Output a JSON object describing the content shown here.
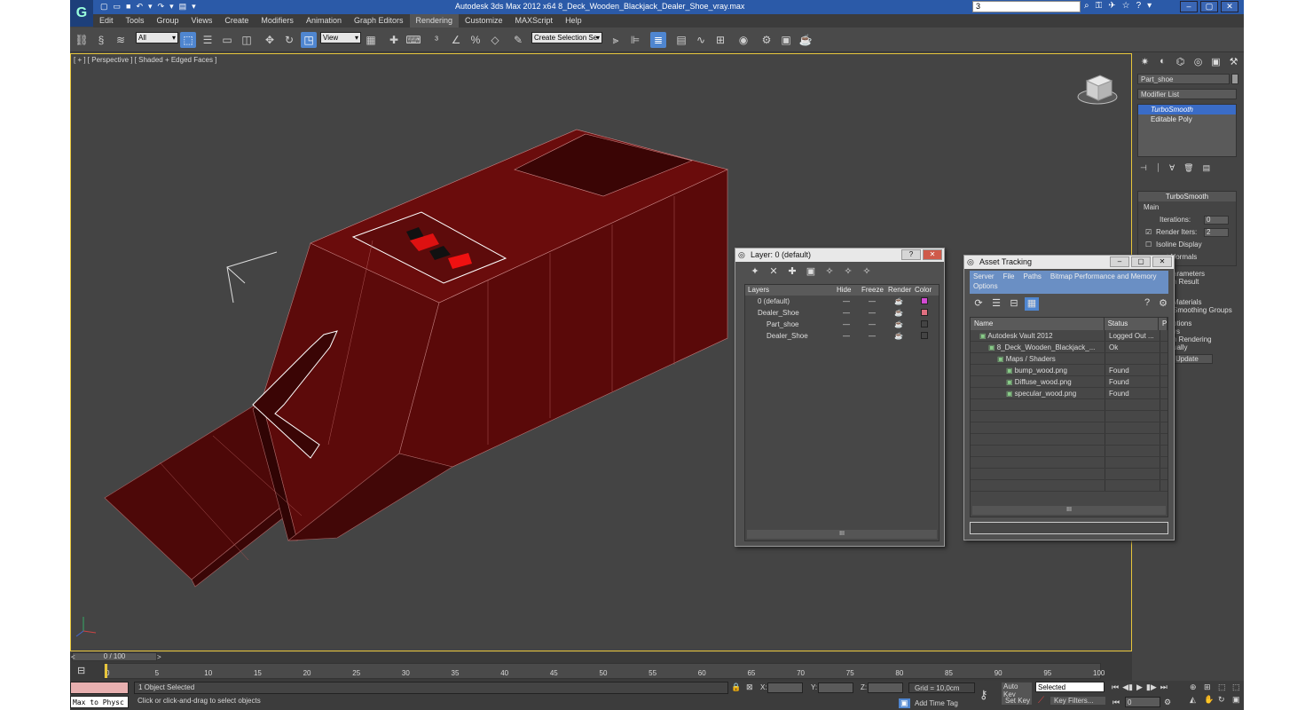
{
  "app": {
    "logo": "G",
    "title": "Autodesk 3ds Max  2012 x64     8_Deck_Wooden_Blackjack_Dealer_Shoe_vray.max",
    "search_value": "3"
  },
  "menu": [
    "Edit",
    "Tools",
    "Group",
    "Views",
    "Create",
    "Modifiers",
    "Animation",
    "Graph Editors",
    "Rendering",
    "Customize",
    "MAXScript",
    "Help"
  ],
  "toolbar": {
    "selection_filter": "All",
    "reference_coord": "View",
    "named_selection_placeholder": "Create Selection Se"
  },
  "viewport": {
    "label": "[ + ] [ Perspective ] [ Shaded + Edged Faces ]",
    "accent_color": "#e7c53b",
    "model_color": "#5a0a0a"
  },
  "command_panel": {
    "object_name": "Part_shoe",
    "modifier_list": "Modifier List",
    "stack": [
      "TurboSmooth",
      "Editable Poly"
    ],
    "rollout_title": "TurboSmooth",
    "main_label": "Main",
    "iterations_label": "Iterations:",
    "iterations_value": "0",
    "render_iters_label": "Render Iters:",
    "render_iters_value": "2",
    "isoline_label": "Isoline Display",
    "explicit_normals_label": "t Normals",
    "params_label": "arameters",
    "smooth_result_label": "h Result",
    "materials_label": "Materials",
    "smoothing_groups_label": "Smoothing Groups",
    "options_label": "ptions",
    "ys_label": "ys",
    "rendering_label": "n Rendering",
    "manually_label": "ually",
    "update_label": "Update"
  },
  "layer_dialog": {
    "title": "Layer: 0 (default)",
    "columns": [
      "Layers",
      "Hide",
      "Freeze",
      "Render",
      "Color"
    ],
    "rows": [
      {
        "name": "0 (default)",
        "color": "#d24ad2",
        "indent": 0
      },
      {
        "name": "Dealer_Shoe",
        "color": "#e07080",
        "indent": 0
      },
      {
        "name": "Part_shoe",
        "color": "#444444",
        "indent": 1
      },
      {
        "name": "Dealer_Shoe",
        "color": "#444444",
        "indent": 1
      }
    ],
    "scroll_thumb": "III"
  },
  "asset_dialog": {
    "title": "Asset Tracking",
    "menu": [
      "Server",
      "File",
      "Paths",
      "Bitmap Performance and Memory"
    ],
    "menu2": "Options",
    "columns": [
      "Name",
      "Status",
      "Pr"
    ],
    "rows": [
      {
        "name": "Autodesk Vault 2012",
        "status": "Logged Out ...",
        "indent": 1
      },
      {
        "name": "8_Deck_Wooden_Blackjack_...",
        "status": "Ok",
        "indent": 2
      },
      {
        "name": "Maps / Shaders",
        "status": "",
        "indent": 3
      },
      {
        "name": "bump_wood.png",
        "status": "Found",
        "indent": 4
      },
      {
        "name": "Diffuse_wood.png",
        "status": "Found",
        "indent": 4
      },
      {
        "name": "specular_wood.png",
        "status": "Found",
        "indent": 4
      }
    ],
    "scroll_thumb": "III"
  },
  "timeline": {
    "frame_counter": "0 / 100",
    "ticks": [
      "0",
      "5",
      "10",
      "15",
      "20",
      "25",
      "30",
      "35",
      "40",
      "45",
      "50",
      "55",
      "60",
      "65",
      "70",
      "75",
      "80",
      "85",
      "90",
      "95",
      "100"
    ]
  },
  "status": {
    "maxscript": "Max to Physc",
    "selected_text": "1 Object Selected",
    "prompt": "Click or click-and-drag to select objects",
    "x_label": "X:",
    "y_label": "Y:",
    "z_label": "Z:",
    "grid": "Grid = 10,0cm",
    "add_time_tag": "Add Time Tag",
    "auto_key": "Auto Key",
    "auto_key_mode": "Selected",
    "set_key": "Set Key",
    "key_filters": "Key Filters...",
    "current_frame": "0"
  }
}
